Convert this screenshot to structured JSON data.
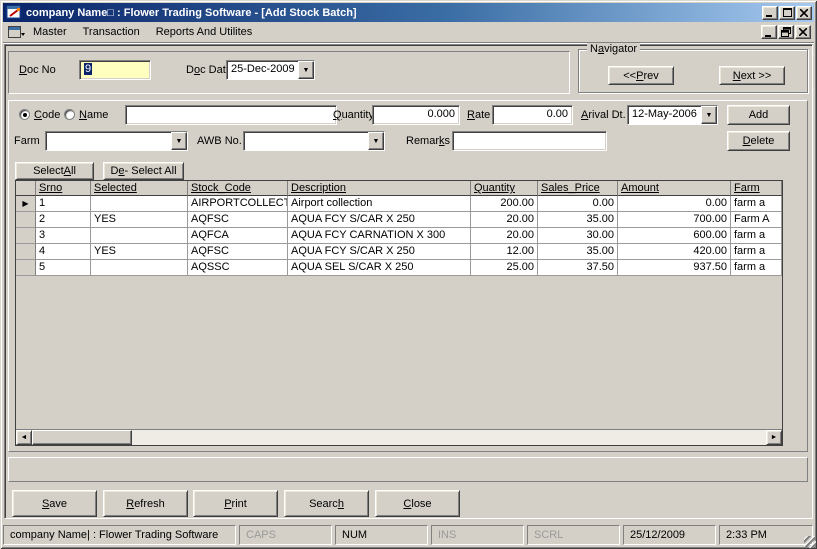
{
  "window": {
    "title": "company Name□ : Flower Trading Software - [Add Stock Batch]"
  },
  "menu": {
    "items": [
      {
        "label": "Master"
      },
      {
        "label": "Transaction"
      },
      {
        "label": "Reports And Utilites"
      }
    ]
  },
  "doc": {
    "no_label": {
      "pre": "",
      "accel": "D",
      "post": "oc No"
    },
    "no_value": "9",
    "date_label": {
      "pre": "D",
      "accel": "o",
      "post": "c Date"
    },
    "date_value": "25-Dec-2009"
  },
  "navigator": {
    "title": {
      "pre": "N",
      "accel": "a",
      "post": "vigator"
    },
    "prev": {
      "pre": "<< ",
      "accel": "P",
      "post": "rev"
    },
    "next": {
      "pre": "",
      "accel": "N",
      "post": "ext >>"
    }
  },
  "entry": {
    "code_label": {
      "pre": "",
      "accel": "C",
      "post": "ode"
    },
    "name_label": {
      "pre": "",
      "accel": "N",
      "post": "ame"
    },
    "search_value": "",
    "quantity_label": {
      "pre": "",
      "accel": "Q",
      "post": "uantity"
    },
    "quantity_value": "0.000",
    "rate_label": {
      "pre": "",
      "accel": "R",
      "post": "ate"
    },
    "rate_value": "0.00",
    "arrival_label": {
      "pre": "",
      "accel": "A",
      "post": "rival Dt."
    },
    "arrival_value": "12-May-2006",
    "add_label": "Add",
    "farm_label": "Farm",
    "farm_value": "",
    "awb_label": "AWB No.",
    "awb_value": "",
    "remarks_label": {
      "pre": "Remar",
      "accel": "k",
      "post": "s"
    },
    "remarks_value": "",
    "delete_label": {
      "pre": "",
      "accel": "D",
      "post": "elete"
    }
  },
  "grid": {
    "select_all": {
      "pre": "Select ",
      "accel": "A",
      "post": "ll"
    },
    "deselect_all": {
      "pre": "D",
      "accel": "e",
      "post": " - Select All"
    },
    "headers": [
      "Srno",
      "Selected",
      "Stock_Code",
      "Description",
      "Quantity",
      "Sales_Price",
      "Amount",
      "Farm"
    ],
    "pointer": "▶",
    "rows": [
      {
        "srno": "1",
        "selected": "",
        "stock_code": "AIRPORTCOLLECT",
        "description": "Airport collection",
        "quantity": "200.00",
        "sales_price": "0.00",
        "amount": "0.00",
        "farm": "farm a"
      },
      {
        "srno": "2",
        "selected": "YES",
        "stock_code": "AQFSC",
        "description": "AQUA FCY S/CAR X 250",
        "quantity": "20.00",
        "sales_price": "35.00",
        "amount": "700.00",
        "farm": "Farm A"
      },
      {
        "srno": "3",
        "selected": "",
        "stock_code": "AQFCA",
        "description": "AQUA FCY CARNATION X 300",
        "quantity": "20.00",
        "sales_price": "30.00",
        "amount": "600.00",
        "farm": "farm a"
      },
      {
        "srno": "4",
        "selected": "YES",
        "stock_code": "AQFSC",
        "description": "AQUA FCY S/CAR X 250",
        "quantity": "12.00",
        "sales_price": "35.00",
        "amount": "420.00",
        "farm": "farm a"
      },
      {
        "srno": "5",
        "selected": "",
        "stock_code": "AQSSC",
        "description": "AQUA SEL S/CAR X 250",
        "quantity": "25.00",
        "sales_price": "37.50",
        "amount": "937.50",
        "farm": "farm a"
      }
    ]
  },
  "actions": {
    "save": {
      "pre": "",
      "accel": "S",
      "post": "ave"
    },
    "refresh": {
      "pre": "",
      "accel": "R",
      "post": "efresh"
    },
    "print": {
      "pre": "",
      "accel": "P",
      "post": "rint"
    },
    "search": {
      "pre": "Searc",
      "accel": "h",
      "post": ""
    },
    "close": {
      "pre": "",
      "accel": "C",
      "post": "lose"
    }
  },
  "statusbar": {
    "app": "company Name| : Flower Trading Software",
    "caps": "CAPS",
    "num": "NUM",
    "ins": "INS",
    "scrl": "SCRL",
    "date": "25/12/2009",
    "time": "2:33 PM"
  },
  "colors": {
    "titlebar_left": "#0a246a",
    "titlebar_right": "#a6caf0",
    "face": "#d4d0c8",
    "docno_field": "#ffffc0",
    "selection": "#0a246a"
  }
}
